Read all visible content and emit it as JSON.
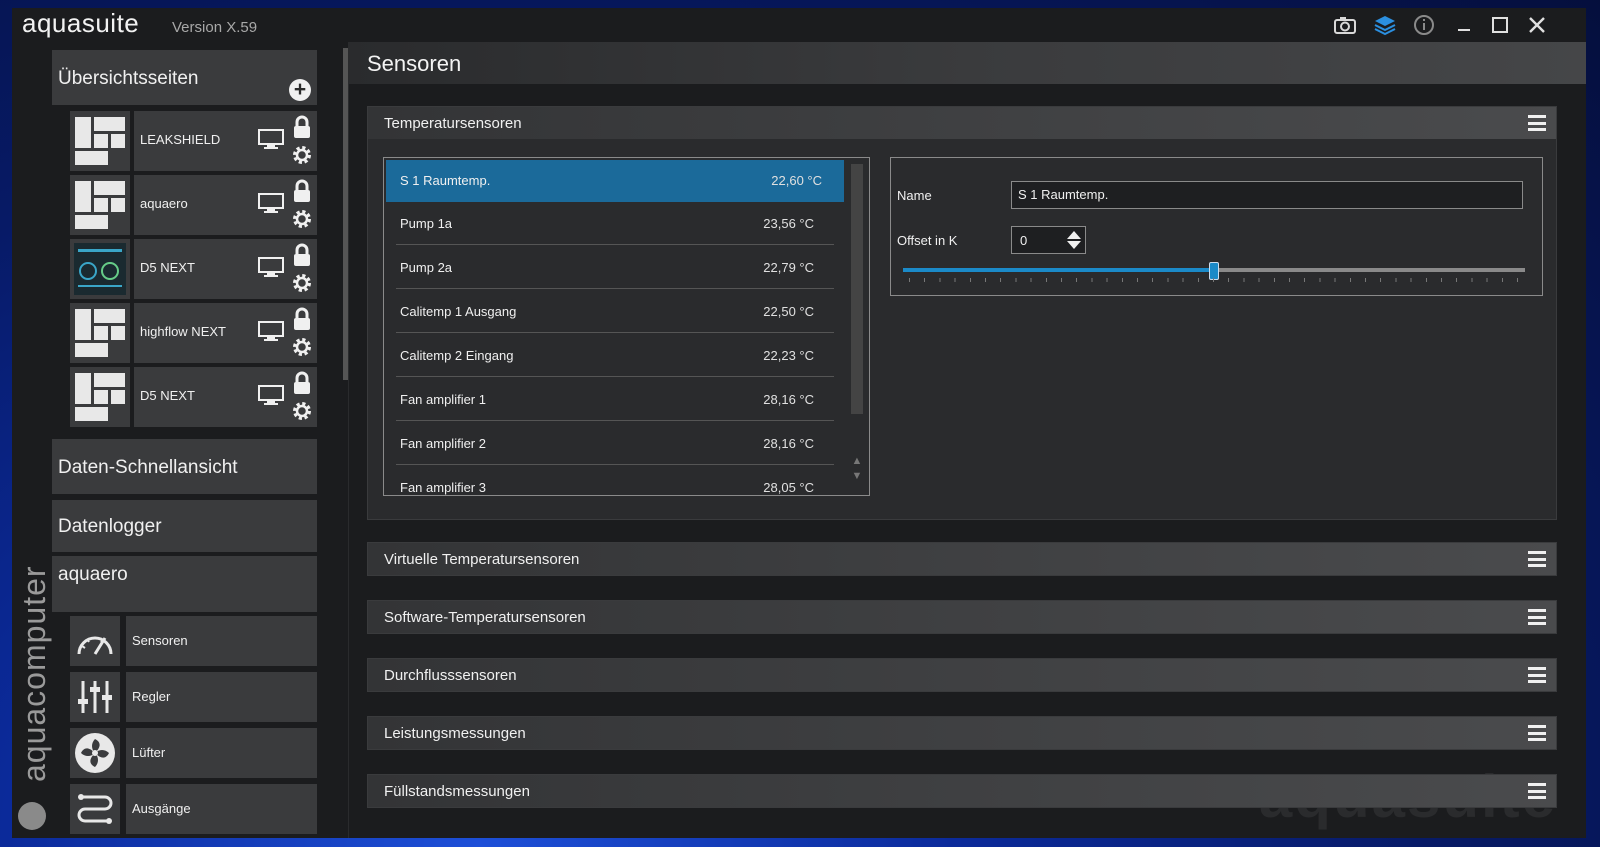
{
  "app": {
    "title": "aquasuite",
    "version": "Version X.59",
    "brand_vertical": "aquacomputer",
    "watermark": "aquasuite"
  },
  "titlebar_icons": [
    "camera-icon",
    "layers-icon",
    "info-icon",
    "minimize-icon",
    "maximize-icon",
    "close-icon"
  ],
  "sidebar": {
    "overview_header": "Übersichtsseiten",
    "devices": [
      {
        "label": "LEAKSHIELD"
      },
      {
        "label": "aquaero"
      },
      {
        "label": "D5 NEXT"
      },
      {
        "label": "highflow NEXT"
      },
      {
        "label": "D5 NEXT"
      }
    ],
    "quick_view": "Daten-Schnellansicht",
    "logger": "Datenlogger",
    "device_section": "aquaero",
    "tools": [
      {
        "label": "Sensoren",
        "icon": "gauge-icon"
      },
      {
        "label": "Regler",
        "icon": "sliders-icon"
      },
      {
        "label": "Lüfter",
        "icon": "fan-icon"
      },
      {
        "label": "Ausgänge",
        "icon": "outputs-icon"
      }
    ]
  },
  "main": {
    "page_title": "Sensoren",
    "temp_panel": {
      "title": "Temperatursensoren",
      "sensors": [
        {
          "name": "S 1 Raumtemp.",
          "value": "22,60 °C"
        },
        {
          "name": "Pump 1a",
          "value": "23,56 °C"
        },
        {
          "name": "Pump 2a",
          "value": "22,79 °C"
        },
        {
          "name": "Calitemp 1 Ausgang",
          "value": "22,50 °C"
        },
        {
          "name": "Calitemp 2 Eingang",
          "value": "22,23 °C"
        },
        {
          "name": "Fan amplifier 1",
          "value": "28,16 °C"
        },
        {
          "name": "Fan amplifier 2",
          "value": "28,16 °C"
        },
        {
          "name": "Fan amplifier 3",
          "value": "28,05 °C"
        }
      ],
      "detail": {
        "name_label": "Name",
        "name_value": "S 1 Raumtemp.",
        "offset_label": "Offset in K",
        "offset_value": "0",
        "slider_fraction": 0.5
      }
    },
    "collapsed_panels": [
      "Virtuelle Temperatursensoren",
      "Software-Temperatursensoren",
      "Durchflusssensoren",
      "Leistungsmessungen",
      "Füllstandsmessungen"
    ]
  },
  "colors": {
    "accent": "#1b8ac8",
    "selection": "#1b6a9a",
    "panel": "#2a2b2d",
    "tile": "#3a3b3d"
  }
}
